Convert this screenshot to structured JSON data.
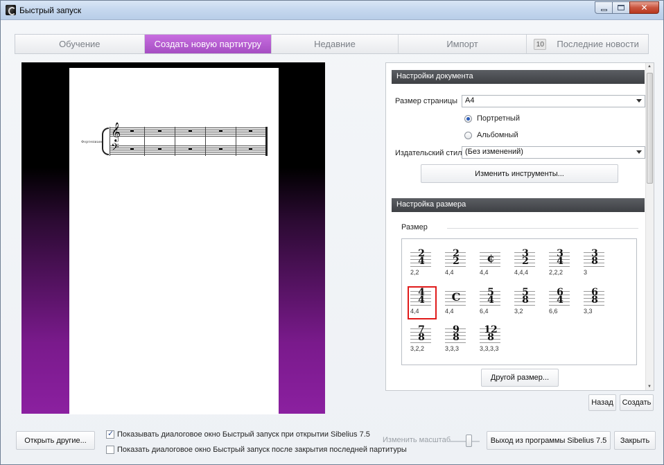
{
  "window": {
    "title": "Быстрый запуск"
  },
  "tabs": [
    {
      "label": "Обучение"
    },
    {
      "label": "Создать новую партитуру"
    },
    {
      "label": "Недавние"
    },
    {
      "label": "Импорт"
    },
    {
      "label": "Последние новости",
      "badge": "10"
    }
  ],
  "preview": {
    "instrument": "Фортепиано"
  },
  "doc_settings": {
    "header": "Настройки документа",
    "page_size_label": "Размер страницы",
    "page_size_value": "A4",
    "portrait_label": "Портретный",
    "landscape_label": "Альбомный",
    "orientation_selected": "portrait",
    "house_style_label": "Издательский стиль",
    "house_style_value": "(Без изменений)",
    "change_instruments_label": "Изменить инструменты..."
  },
  "time_settings": {
    "header": "Настройка размера",
    "size_label": "Размер",
    "signatures": [
      {
        "num": "2",
        "den": "4",
        "group": "2,2"
      },
      {
        "num": "2",
        "den": "2",
        "group": "4,4"
      },
      {
        "num": "¢",
        "den": "",
        "group": "4,4"
      },
      {
        "num": "3",
        "den": "2",
        "group": "4,4,4"
      },
      {
        "num": "3",
        "den": "4",
        "group": "2,2,2"
      },
      {
        "num": "3",
        "den": "8",
        "group": "3"
      },
      {
        "num": "4",
        "den": "4",
        "group": "4,4",
        "selected": true
      },
      {
        "num": "C",
        "den": "",
        "group": "4,4"
      },
      {
        "num": "5",
        "den": "4",
        "group": "6,4"
      },
      {
        "num": "5",
        "den": "8",
        "group": "3,2"
      },
      {
        "num": "6",
        "den": "4",
        "group": "6,6"
      },
      {
        "num": "6",
        "den": "8",
        "group": "3,3"
      },
      {
        "num": "7",
        "den": "8",
        "group": "3,2,2"
      },
      {
        "num": "9",
        "den": "8",
        "group": "3,3,3"
      },
      {
        "num": "12",
        "den": "8",
        "group": "3,3,3,3"
      }
    ],
    "other_size_label": "Другой размер..."
  },
  "actions": {
    "back_label": "Назад",
    "create_label": "Создать"
  },
  "footer": {
    "open_other_label": "Открыть другие...",
    "show_on_start_label": "Показывать диалоговое окно Быстрый запуск при открытии Sibelius 7.5",
    "show_on_start_checked": true,
    "show_after_close_label": "Показать диалоговое окно Быстрый запуск после закрытия последней партитуры",
    "show_after_close_checked": false,
    "zoom_label": "Изменить масштаб",
    "exit_label": "Выход из программы Sibelius 7.5",
    "close_label": "Закрыть"
  },
  "colors": {
    "accent_tab": "#b55fd3",
    "selection_outline": "#e01a1a",
    "section_header": "#4a4c50"
  }
}
